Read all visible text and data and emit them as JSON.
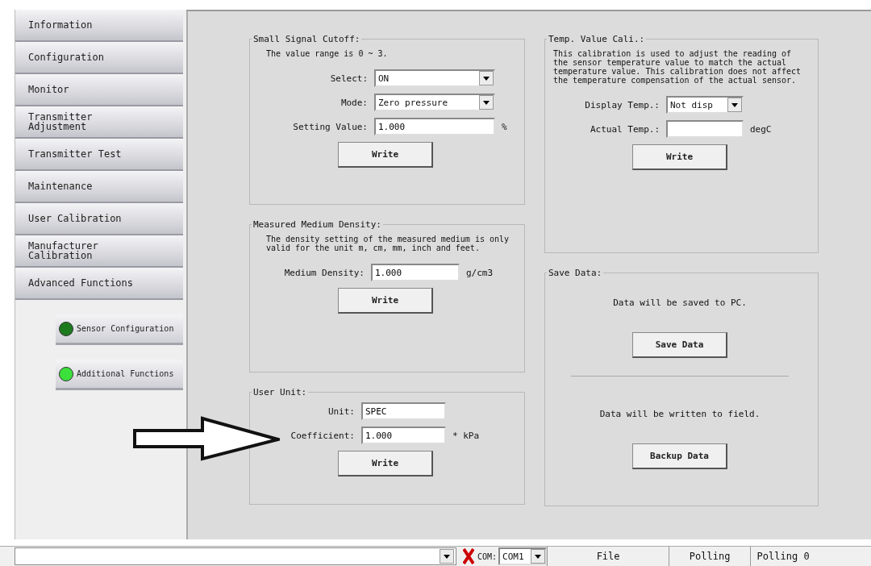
{
  "sidebar": {
    "items": [
      {
        "label": "Information",
        "selected": false
      },
      {
        "label": "Configuration",
        "selected": false
      },
      {
        "label": "Monitor",
        "selected": false
      },
      {
        "label": "Transmitter Adjustment",
        "selected": false
      },
      {
        "label": "Transmitter Test",
        "selected": false
      },
      {
        "label": "Maintenance",
        "selected": false
      },
      {
        "label": "User Calibration",
        "selected": false
      },
      {
        "label": "Manufacturer Calibration",
        "selected": false
      },
      {
        "label": "Advanced Functions",
        "selected": false
      }
    ],
    "subitems": [
      {
        "label": "Sensor Configuration",
        "selected": false
      },
      {
        "label": "Additional Functions",
        "selected": true
      }
    ]
  },
  "left_groups": [
    {
      "title": "Small Signal Cutoff:",
      "note": "The value range is 0 ~ 3.",
      "rows": [
        {
          "kind": "select",
          "label": "Select:",
          "value": "ON"
        },
        {
          "kind": "select",
          "label": "Mode:",
          "value": "Zero pressure"
        },
        {
          "kind": "text",
          "label": "Setting Value:",
          "value": "1.000",
          "unit": "%"
        }
      ],
      "button": "Write"
    },
    {
      "title": "Measured Medium Density:",
      "note": "The density setting of the measured medium is only valid for the unit m, cm, mm, inch and feet.",
      "rows": [
        {
          "kind": "text",
          "label": "Medium Density:",
          "value": "1.000",
          "unit": "g/cm3"
        }
      ],
      "button": "Write"
    },
    {
      "title": "User Unit:",
      "rows": [
        {
          "kind": "text",
          "label": "Unit:",
          "value": "SPEC"
        },
        {
          "kind": "text",
          "label": "Coefficient:",
          "value": "1.000",
          "unit": "* kPa"
        }
      ],
      "button": "Write"
    }
  ],
  "temp_group": {
    "title": "Temp. Value Cali.:",
    "note": "This calibration is used to adjust the reading of the sensor temperature value to match the actual temperature value. This calibration does not affect the temperature compensation of the actual sensor.",
    "rows": [
      {
        "kind": "select",
        "label": "Display Temp.:",
        "value": "Not disp"
      },
      {
        "kind": "text",
        "label": "Actual Temp.:",
        "unit": "degC"
      }
    ],
    "button": "Write"
  },
  "save_group": {
    "title": "Save Data:",
    "sections": [
      {
        "text": "Data will be saved to PC.",
        "button": "Save Data"
      },
      {
        "text": "Data will be written to field.",
        "button": "Backup Data"
      }
    ]
  },
  "status_bar": {
    "com_label": "COM:",
    "com_port": "COM1",
    "panes": [
      "File",
      "Polling",
      "Polling 0"
    ]
  }
}
